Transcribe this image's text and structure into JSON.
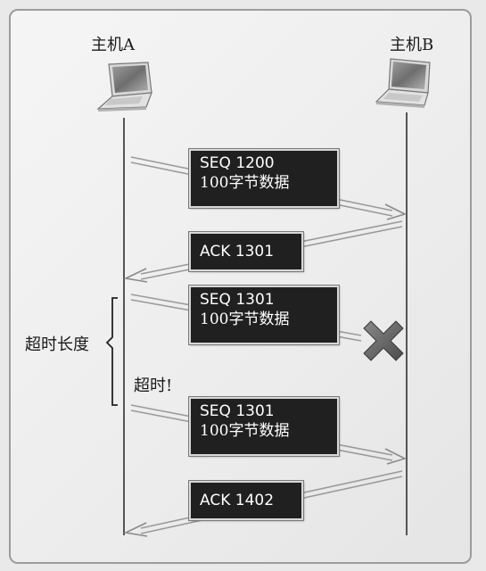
{
  "hosts": {
    "a": {
      "label": "主机A"
    },
    "b": {
      "label": "主机B"
    }
  },
  "packets": [
    {
      "line1": "SEQ 1200",
      "line2": "100字节数据"
    },
    {
      "line1": "ACK 1301"
    },
    {
      "line1": "SEQ 1301",
      "line2": "100字节数据"
    },
    {
      "line1": "SEQ 1301",
      "line2": "100字节数据"
    },
    {
      "line1": "ACK 1402"
    }
  ],
  "timeout": {
    "length_label": "超时长度",
    "event_label": "超时!"
  },
  "colors": {
    "packet_bg": "#202020",
    "packet_text": "#ffffff",
    "arrow": "#9a9a9a",
    "lost_marker": "#6a6a6a"
  },
  "icons": [
    "laptop-icon",
    "laptop-icon",
    "lost-packet-x-icon"
  ]
}
